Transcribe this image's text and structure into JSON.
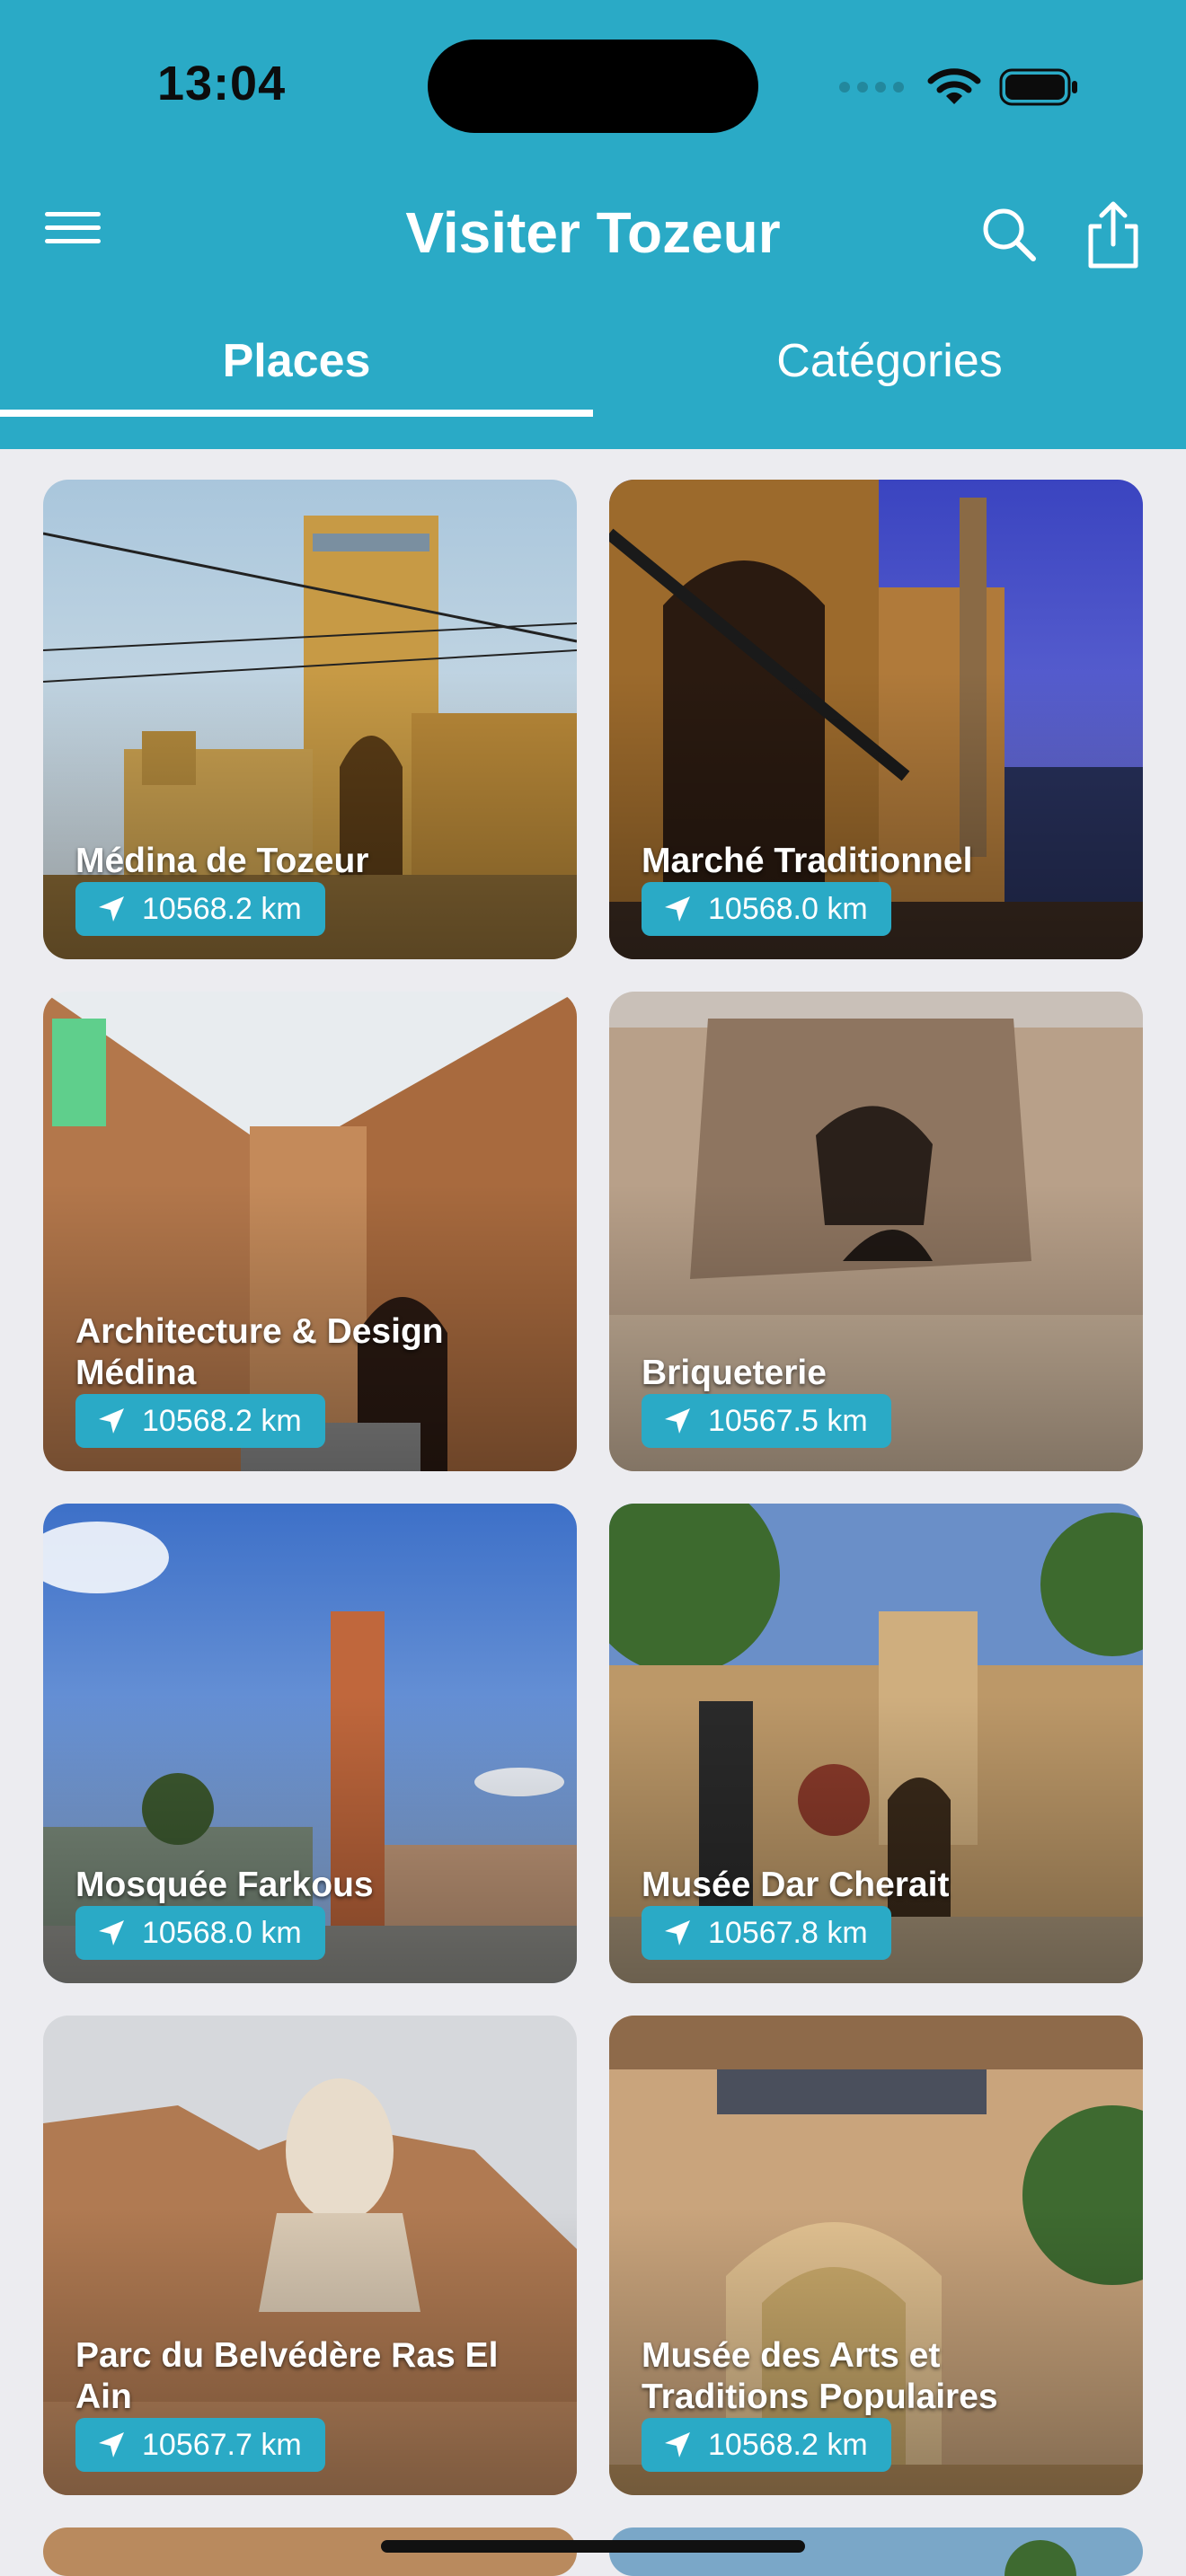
{
  "status_bar": {
    "time": "13:04"
  },
  "header": {
    "title": "Visiter Tozeur",
    "menu_icon": "hamburger-menu-icon",
    "search_icon": "search-icon",
    "share_icon": "share-icon",
    "bg_color": "#2aaac6"
  },
  "tabs": [
    {
      "label": "Places",
      "active": true
    },
    {
      "label": "Catégories",
      "active": false
    }
  ],
  "places": [
    {
      "name": "Médina de Tozeur",
      "distance": "10568.2 km"
    },
    {
      "name": "Marché Traditionnel",
      "distance": "10568.0 km"
    },
    {
      "name": "Architecture & Design Médina",
      "distance": "10568.2 km"
    },
    {
      "name": "Briqueterie",
      "distance": "10567.5 km"
    },
    {
      "name": "Mosquée Farkous",
      "distance": "10568.0 km"
    },
    {
      "name": "Musée Dar Cherait",
      "distance": "10567.8 km"
    },
    {
      "name": "Parc du Belvédère  Ras El Ain",
      "distance": "10567.7 km"
    },
    {
      "name": "Musée des Arts et Traditions Populaires",
      "distance": "10568.2 km"
    }
  ],
  "accent_color": "#2aaac6"
}
